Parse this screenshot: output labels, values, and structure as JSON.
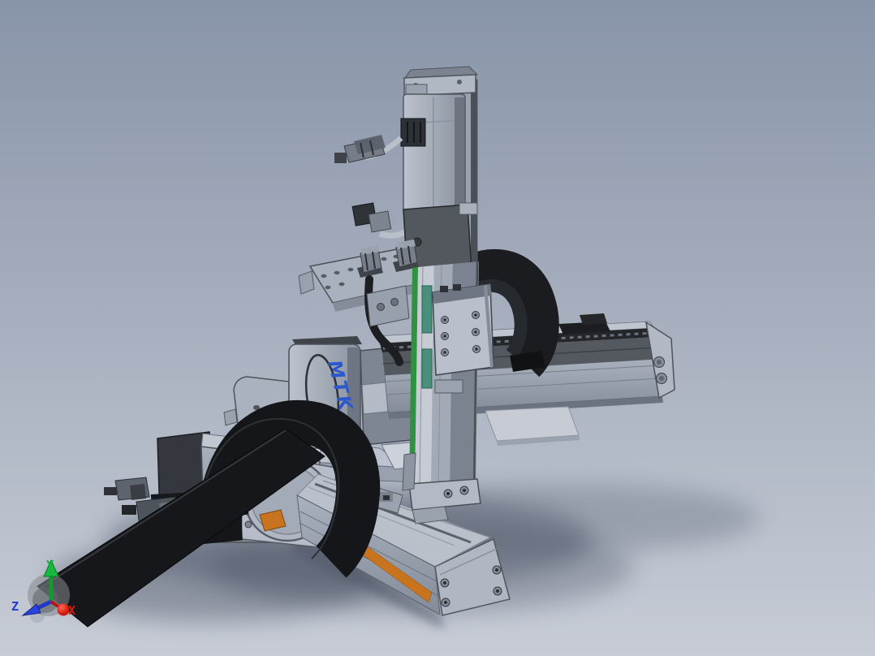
{
  "viewport": {
    "kind": "cad-3d-viewport",
    "background_top": "#8894a8",
    "background_bottom": "#c7ccd6",
    "shadow_color": "#4d5566"
  },
  "model": {
    "name": "3-axis XYZ gantry robot assembly",
    "components": [
      {
        "id": "z-axis-motor",
        "label": "Z-axis motor with connectors and cables"
      },
      {
        "id": "z-axis-rail",
        "label": "Z-axis vertical linear actuator"
      },
      {
        "id": "z-carriage",
        "label": "Z-axis carriage block"
      },
      {
        "id": "x-axis-rail",
        "label": "X-axis horizontal linear actuator"
      },
      {
        "id": "x-axis-motor",
        "label": "X-axis motor (MTK)"
      },
      {
        "id": "y-axis-rail",
        "label": "Y-axis linear actuator"
      },
      {
        "id": "y-axis-motor",
        "label": "Y-axis motor with round flange"
      },
      {
        "id": "upper-drag-chain",
        "label": "Upper cable drag chain"
      },
      {
        "id": "lower-drag-chain",
        "label": "Lower cable drag chain"
      },
      {
        "id": "mounting-plate",
        "label": "Connector mounting plate"
      }
    ]
  },
  "branding": {
    "logo_text": "MTK",
    "logo_color": "#2b58cc"
  },
  "orientation_triad": {
    "x": {
      "label": "X",
      "color": "#e01612"
    },
    "y": {
      "label": "Y",
      "color": "#14b53c"
    },
    "z": {
      "label": "Z",
      "color": "#2238d8"
    }
  },
  "palette": {
    "metal_light": "#c0c6d0",
    "metal_mid": "#9aa2b0",
    "metal_dark": "#565b63",
    "chain_black": "#17191c",
    "accent_orange": "#c8741f",
    "pcb_green": "#2e9240",
    "pcb_teal": "#49907c"
  }
}
